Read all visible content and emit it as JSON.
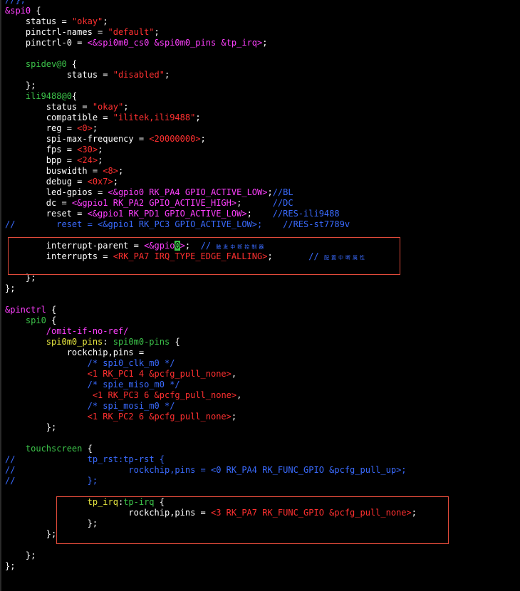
{
  "colors": {
    "background": "#000000",
    "text": "#ffffff",
    "string": "#ff3030",
    "macro": "#ff40ff",
    "comment": "#3a6bff",
    "label": "#3cc44a",
    "highlight_box": "#e04a3a"
  },
  "code": {
    "l00": "//};",
    "l01_a": "&spi0",
    "l01_b": " {",
    "l02_a": "    status = ",
    "l02_b": "\"okay\"",
    "l02_c": ";",
    "l03_a": "    pinctrl-names = ",
    "l03_b": "\"default\"",
    "l03_c": ";",
    "l04_a": "    pinctrl-0 = ",
    "l04_b": "<&spi0m0_cs0 &spi0m0_pins &tp_irq>",
    "l04_c": ";",
    "l06_a": "    ",
    "l06_b": "spidev@0",
    "l06_c": " {",
    "l07_a": "            status = ",
    "l07_b": "\"disabled\"",
    "l07_c": ";",
    "l08": "    };",
    "l09_a": "    ",
    "l09_b": "ili9488@0",
    "l09_c": "{",
    "l10_a": "        status = ",
    "l10_b": "\"okay\"",
    "l10_c": ";",
    "l11_a": "        compatible = ",
    "l11_b": "\"ilitek,ili9488\"",
    "l11_c": ";",
    "l12_a": "        reg = ",
    "l12_b": "<0>",
    "l12_c": ";",
    "l13_a": "        spi-max-frequency = ",
    "l13_b": "<20000000>",
    "l13_c": ";",
    "l14_a": "        fps = ",
    "l14_b": "<30>",
    "l14_c": ";",
    "l15_a": "        bpp = ",
    "l15_b": "<24>",
    "l15_c": ";",
    "l16_a": "        buswidth = ",
    "l16_b": "<8>",
    "l16_c": ";",
    "l17_a": "        debug = ",
    "l17_b": "<0x7>",
    "l17_c": ";",
    "l18_a": "        led-gpios = ",
    "l18_b": "<&gpio0 RK_PA4 GPIO_ACTIVE_LOW>",
    "l18_c": ";",
    "l18_d": "//BL",
    "l19_a": "        dc = ",
    "l19_b": "<&gpio1 RK_PA2 GPIO_ACTIVE_HIGH>",
    "l19_c": ";      ",
    "l19_d": "//DC",
    "l20_a": "        reset = ",
    "l20_b": "<&gpio1 RK_PD1 GPIO_ACTIVE_LOW>",
    "l20_c": ";    ",
    "l20_d": "//RES-ili9488",
    "l21": "//        reset = <&gpio1 RK_PC3 GPIO_ACTIVE_LOW>;    //RES-st7789v",
    "l23_a": "        interrupt-parent = ",
    "l23_b": "<&gpio",
    "l23_cursor": "0",
    "l23_c": ">",
    "l23_d": ";  ",
    "l23_e": "// ",
    "l23_f": "触发中断控制器",
    "l24_a": "        interrupts = ",
    "l24_b": "<RK_PA7 IRQ_TYPE_EDGE_FALLING>",
    "l24_c": ";       ",
    "l24_d": "// ",
    "l24_e": "配置中断属性",
    "l26": "    };",
    "l27": "};",
    "l29_a": "&pinctrl",
    "l29_b": " {",
    "l30_a": "    ",
    "l30_b": "spi0",
    "l30_c": " {",
    "l31_a": "        ",
    "l31_b": "/omit-if-no-ref/",
    "l32_a": "        ",
    "l32_b": "spi0m0_pins",
    "l32_c": ": ",
    "l32_d": "spi0m0-pins",
    "l32_e": " {",
    "l33": "            rockchip,pins =",
    "l34_a": "                ",
    "l34_b": "/* spi0_clk_m0 */",
    "l35_a": "                ",
    "l35_b": "<1 RK_PC1 4 &pcfg_pull_none>",
    "l35_c": ",",
    "l36_a": "                ",
    "l36_b": "/* spie_miso_m0 */",
    "l37_a": "                 ",
    "l37_b": "<1 RK_PC3 6 &pcfg_pull_none>",
    "l37_c": ",",
    "l38_a": "                ",
    "l38_b": "/* spi_mosi_m0 */",
    "l39_a": "                ",
    "l39_b": "<1 RK_PC2 6 &pcfg_pull_none>",
    "l39_c": ";",
    "l40": "        };",
    "l42_a": "    ",
    "l42_b": "touchscreen",
    "l42_c": " {",
    "l43_a": "//",
    "l43_b": "              ",
    "l43_c": "tp_rst",
    "l43_d": ":tp-rst {",
    "l44": "//                      rockchip,pins = <0 RK_PA4 RK_FUNC_GPIO &pcfg_pull_up>;",
    "l45": "//              };",
    "l47_a": "                ",
    "l47_b": "tp_irq",
    "l47_c": ":",
    "l47_d": "tp-irq",
    "l47_e": " {",
    "l48_a": "                        rockchip,pins = ",
    "l48_b": "<3 RK_PA7 RK_FUNC_GPIO &pcfg_pull_none>",
    "l48_c": ";",
    "l49": "                };",
    "l50": "        };",
    "l52": "    };",
    "l53": "};"
  }
}
